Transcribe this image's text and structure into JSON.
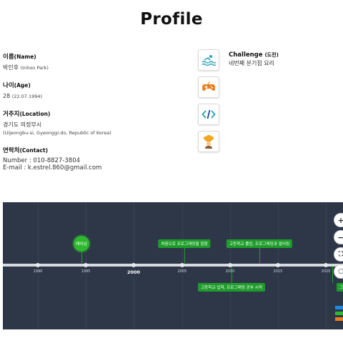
{
  "page": {
    "title": "Profile"
  },
  "profile": {
    "name_label": "이름",
    "name_label_en": "(Name)",
    "name_value": "박인후",
    "name_value_en": "(Inhoo Park)",
    "age_label": "나이",
    "age_label_en": "(Age)",
    "age_value": "28",
    "age_value_en": "(22.07.1994)",
    "location_label": "거주지",
    "location_label_en": "(Location)",
    "location_value": "경기도 의정부시",
    "location_value_en": "(Uijeongbu-si, Gyeonggi-do, Republic of Korea)",
    "contact_label": "연락처",
    "contact_label_en": "(Contact)",
    "contact_number": "Number : 010-8827-3804",
    "contact_email": "E-mail : k.estrel.860@gmail.com"
  },
  "challenge": {
    "title": "Challenge",
    "title_ko": "(도전)",
    "subtitle": "네번째 분기점 요리"
  },
  "icons": [
    "swimming-icon",
    "gamepad-icon",
    "code-icon",
    "chef-icon"
  ],
  "timeline": {
    "ticks": [
      {
        "label": "1990",
        "major": false
      },
      {
        "label": "1995",
        "major": false
      },
      {
        "label": "2000",
        "major": true
      },
      {
        "label": "2005",
        "major": false
      },
      {
        "label": "2010",
        "major": false
      },
      {
        "label": "2015",
        "major": false
      },
      {
        "label": "2020",
        "major": false
      }
    ],
    "events": {
      "birth": "태어남",
      "first_programming": "처음으로 프로그래밍을 접함",
      "hs_grad": "고등학교 졸업, 프로그래밍과 멀어짐",
      "hs_entry": "고등학교 입학, 프로그래밍 공부 시작",
      "cut": "그린 오"
    },
    "controls": [
      "+",
      "−",
      "⛶",
      "○"
    ],
    "accent": "#1f9d2b",
    "background": "#2d3748"
  }
}
